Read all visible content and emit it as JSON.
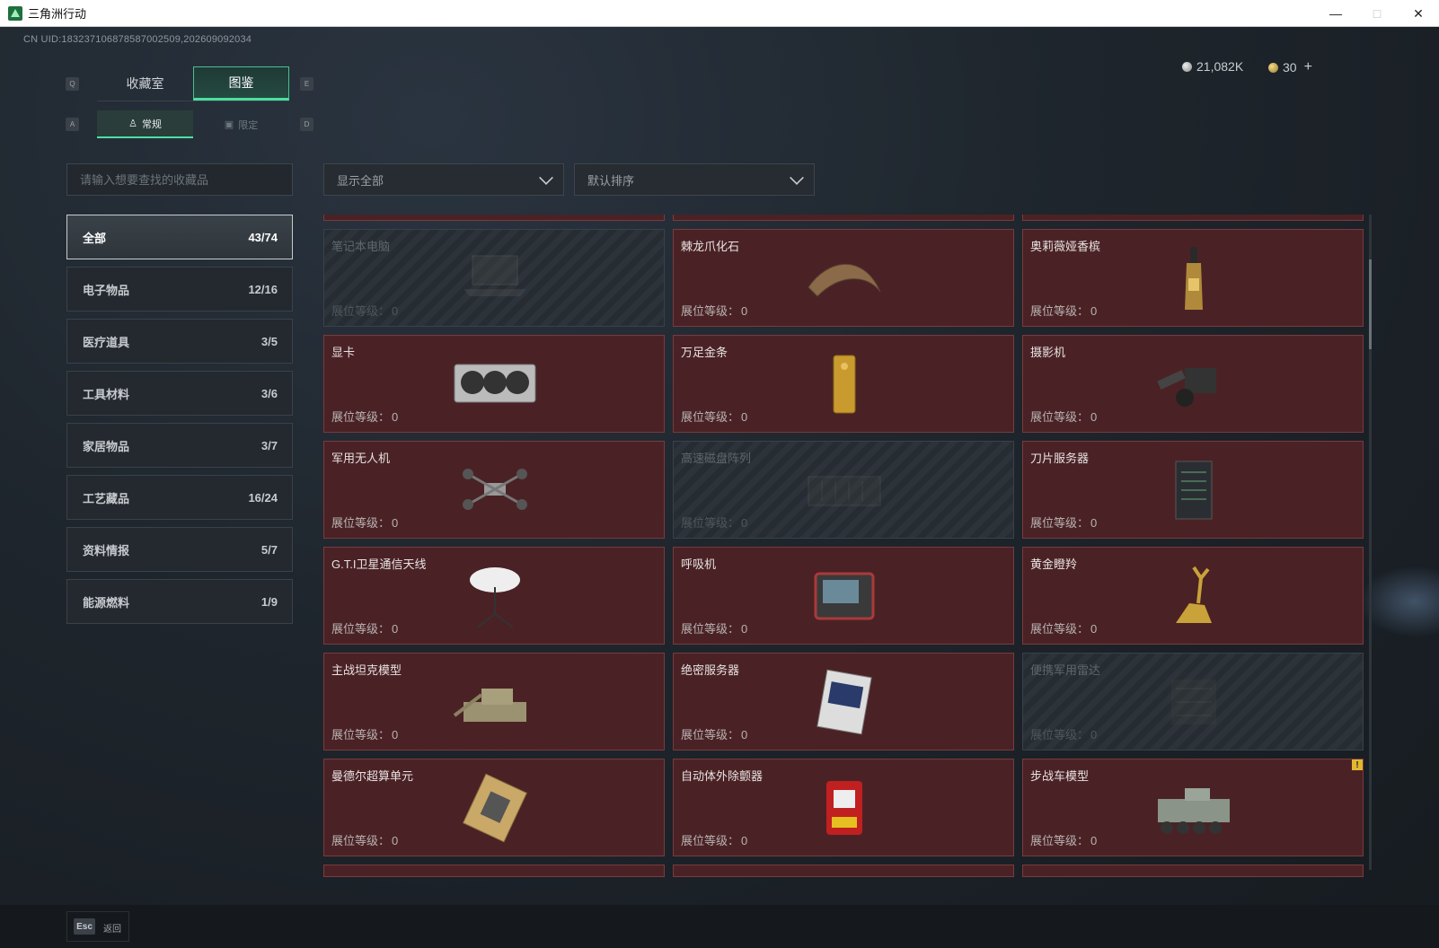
{
  "window": {
    "title": "三角洲行动",
    "minimize": "—",
    "maximize": "□",
    "close": "✕"
  },
  "uid": "CN UID:1832371068785870025­09,202609092034",
  "currency": {
    "silver": "21,082K",
    "gold": "30",
    "add": "+"
  },
  "keyhints": {
    "q": "Q",
    "e": "E",
    "a": "A",
    "d": "D"
  },
  "main_tabs": [
    {
      "label": "收藏室"
    },
    {
      "label": "图鉴"
    }
  ],
  "sub_tabs": [
    {
      "label": "常规",
      "icon": "figure-icon"
    },
    {
      "label": "限定",
      "icon": "frame-icon"
    }
  ],
  "search": {
    "placeholder": "请输入想要查找的收藏品"
  },
  "filters": {
    "show": "显示全部",
    "sort": "默认排序"
  },
  "categories": [
    {
      "label": "全部",
      "count": "43/74"
    },
    {
      "label": "电子物品",
      "count": "12/16"
    },
    {
      "label": "医疗道具",
      "count": "3/5"
    },
    {
      "label": "工具材料",
      "count": "3/6"
    },
    {
      "label": "家居物品",
      "count": "3/7"
    },
    {
      "label": "工艺藏品",
      "count": "16/24"
    },
    {
      "label": "资料情报",
      "count": "5/7"
    },
    {
      "label": "能源燃料",
      "count": "1/9"
    }
  ],
  "level_label": "展位等级：",
  "items": [
    {
      "name": "笔记本电脑",
      "level": "0",
      "locked": true,
      "icon": "laptop-icon"
    },
    {
      "name": "棘龙爪化石",
      "level": "0",
      "locked": false,
      "icon": "claw-fossil-icon"
    },
    {
      "name": "奥莉薇娅香槟",
      "level": "0",
      "locked": false,
      "icon": "champagne-icon"
    },
    {
      "name": "显卡",
      "level": "0",
      "locked": false,
      "icon": "graphics-card-icon"
    },
    {
      "name": "万足金条",
      "level": "0",
      "locked": false,
      "icon": "gold-bar-icon"
    },
    {
      "name": "摄影机",
      "level": "0",
      "locked": false,
      "icon": "camera-icon"
    },
    {
      "name": "军用无人机",
      "level": "0",
      "locked": false,
      "icon": "drone-icon"
    },
    {
      "name": "高速磁盘阵列",
      "level": "0",
      "locked": true,
      "icon": "disk-array-icon"
    },
    {
      "name": "刀片服务器",
      "level": "0",
      "locked": false,
      "icon": "blade-server-icon"
    },
    {
      "name": "G.T.I卫星通信天线",
      "level": "0",
      "locked": false,
      "icon": "satellite-dish-icon"
    },
    {
      "name": "呼吸机",
      "level": "0",
      "locked": false,
      "icon": "ventilator-icon"
    },
    {
      "name": "黄金瞪羚",
      "level": "0",
      "locked": false,
      "icon": "golden-gazelle-icon"
    },
    {
      "name": "主战坦克模型",
      "level": "0",
      "locked": false,
      "icon": "tank-model-icon"
    },
    {
      "name": "绝密服务器",
      "level": "0",
      "locked": false,
      "icon": "secret-server-icon"
    },
    {
      "name": "便携军用雷达",
      "level": "0",
      "locked": true,
      "icon": "radar-icon"
    },
    {
      "name": "曼德尔超算单元",
      "level": "0",
      "locked": false,
      "icon": "compute-unit-icon"
    },
    {
      "name": "自动体外除颤器",
      "level": "0",
      "locked": false,
      "icon": "defibrillator-icon"
    },
    {
      "name": "步战车模型",
      "level": "0",
      "locked": false,
      "icon": "ifv-model-icon",
      "warning": "!"
    }
  ],
  "bottom": {
    "esc": "Esc",
    "back": "返回"
  }
}
